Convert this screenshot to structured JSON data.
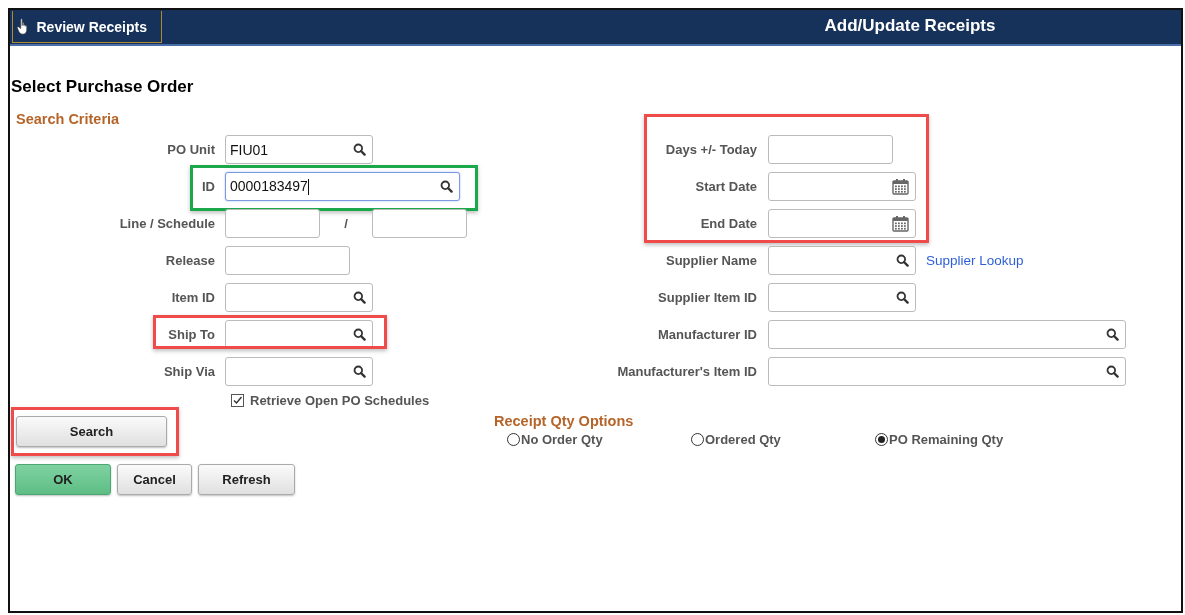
{
  "header": {
    "back_link": "Review Receipts",
    "title": "Add/Update Receipts"
  },
  "page_title": "Select Purchase Order",
  "section_title": "Search Criteria",
  "left_fields": [
    {
      "kind": "lookup",
      "label": "PO Unit",
      "value": "FIU01"
    },
    {
      "kind": "lookup",
      "label": "ID",
      "value": "0000183497",
      "focused": true,
      "color": "#1aa84a"
    },
    {
      "kind": "pair",
      "label": "Line / Schedule",
      "separator": "/"
    },
    {
      "kind": "plain",
      "label": "Release"
    },
    {
      "kind": "lookup",
      "label": "Item ID"
    },
    {
      "kind": "lookup",
      "label": "Ship To",
      "color": "#ef4b4b"
    },
    {
      "kind": "lookup",
      "label": "Ship Via"
    }
  ],
  "date_group": {
    "color": "#ef4b4b",
    "fields": [
      {
        "kind": "plain",
        "label": "Days +/- Today"
      },
      {
        "kind": "date",
        "label": "Start Date"
      },
      {
        "kind": "date",
        "label": "End Date"
      }
    ]
  },
  "right_fields": [
    {
      "kind": "lookup",
      "label": "Supplier Name",
      "link": "Supplier Lookup"
    },
    {
      "kind": "lookup",
      "label": "Supplier Item ID"
    },
    {
      "kind": "lookup",
      "label": "Manufacturer ID"
    },
    {
      "kind": "lookup",
      "label": "Manufacturer's Item ID"
    }
  ],
  "retrieve_open": {
    "label": "Retrieve Open PO Schedules",
    "checked": true
  },
  "search_button": {
    "label": "Search",
    "color": "#ef4b4b"
  },
  "receipt_qty": {
    "title": "Receipt Qty Options",
    "options": [
      {
        "label": "No Order Qty",
        "selected": false
      },
      {
        "label": "Ordered Qty",
        "selected": false
      },
      {
        "label": "PO Remaining Qty",
        "selected": true
      }
    ]
  },
  "buttons": [
    {
      "label": "OK",
      "kind": "primary"
    },
    {
      "label": "Cancel",
      "kind": "secondary"
    },
    {
      "label": "Refresh",
      "kind": "secondary"
    }
  ]
}
